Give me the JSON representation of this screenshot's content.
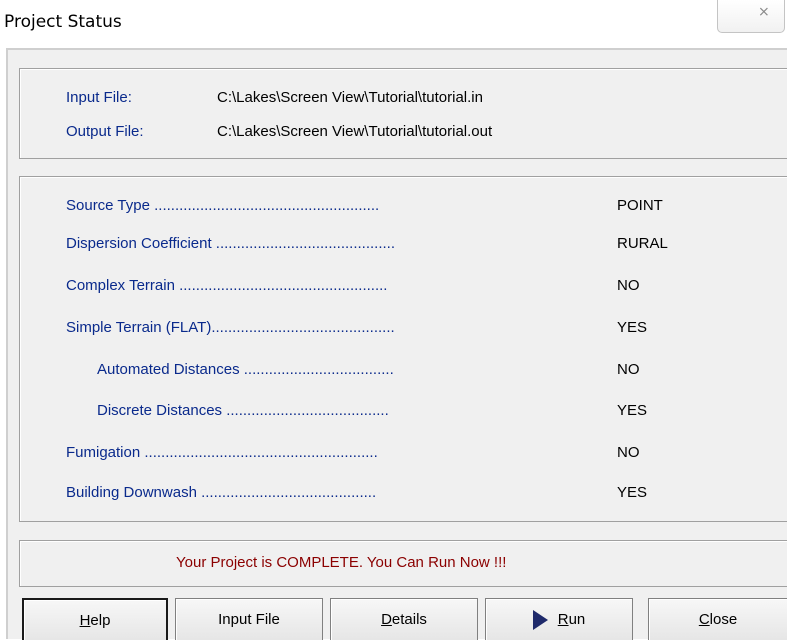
{
  "window": {
    "title": "Project Status",
    "close_glyph": "⨯"
  },
  "files": {
    "input_label": "Input File:",
    "input_value": "C:\\Lakes\\Screen View\\Tutorial\\tutorial.in",
    "output_label": "Output File:",
    "output_value": "C:\\Lakes\\Screen View\\Tutorial\\tutorial.out"
  },
  "settings": [
    {
      "label": "Source Type ......................................................",
      "value": "POINT"
    },
    {
      "label": "Dispersion Coefficient ...........................................",
      "value": "RURAL"
    },
    {
      "label": "Complex Terrain ..................................................",
      "value": "NO"
    },
    {
      "label": "Simple Terrain  (FLAT)............................................",
      "value": "YES"
    },
    {
      "label": "Automated Distances ....................................",
      "value": "NO"
    },
    {
      "label": "Discrete Distances .......................................",
      "value": "YES"
    },
    {
      "label": "Fumigation ........................................................",
      "value": "NO"
    },
    {
      "label": "Building Downwash ..........................................",
      "value": "YES"
    }
  ],
  "status_message": "Your Project is COMPLETE.  You Can Run Now !!!",
  "buttons": {
    "help": {
      "mnemonic": "H",
      "rest": "elp"
    },
    "input_file": "Input File",
    "details": {
      "mnemonic": "D",
      "rest": "etails"
    },
    "run": {
      "mnemonic": "R",
      "rest": "un"
    },
    "close": {
      "mnemonic": "C",
      "rest": "lose"
    }
  },
  "icons": {
    "run": "play-icon",
    "close": "close-icon"
  }
}
